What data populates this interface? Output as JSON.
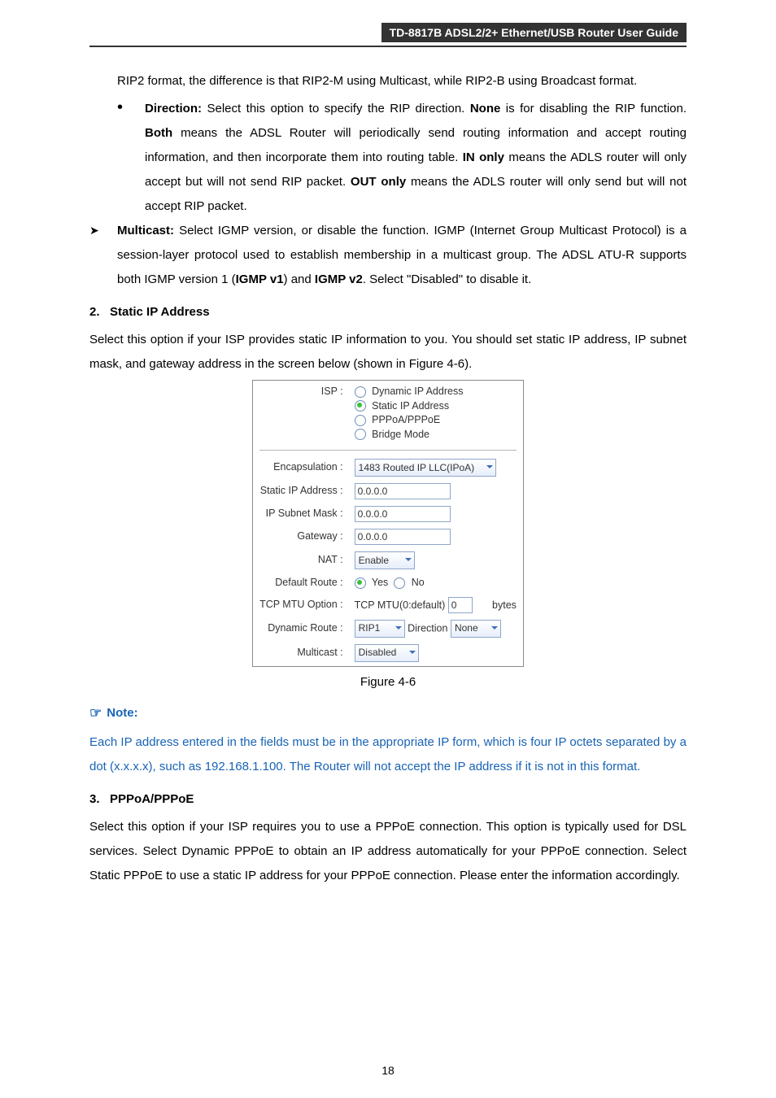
{
  "header": {
    "title": "TD-8817B   ADSL2/2+  Ethernet/USB  Router  User  Guide"
  },
  "body": {
    "p1": "RIP2 format, the difference is that RIP2-M using Multicast, while RIP2-B using Broadcast format.",
    "dir_label": "Direction:",
    "dir_text": " Select this option to specify the RIP direction. ",
    "none": "None",
    "dir_text2": " is for disabling the RIP function. ",
    "both": "Both",
    "dir_text3": " means the ADSL Router will periodically send routing information and accept routing information, and then incorporate them into routing table. ",
    "inonly": "IN only",
    "dir_text4": " means the ADLS router will only accept but will not send RIP packet. ",
    "outonly": "OUT only",
    "dir_text5": " means the ADLS router will only send but will not accept RIP packet.",
    "mcast_label": "Multicast:",
    "mcast_text1": " Select IGMP version, or disable the function. IGMP (Internet Group Multicast Protocol) is a session-layer protocol used to establish membership in a multicast group. The ADSL ATU-R supports both IGMP version 1 (",
    "igmpv1": "IGMP v1",
    "mcast_text2": ") and ",
    "igmpv2": "IGMP v2",
    "mcast_text3": ". Select \"Disabled\" to disable it.",
    "s2_num": "2.",
    "s2_title": "Static IP Address",
    "p2": "Select this option if your ISP provides static IP information to you. You should set static IP address, IP subnet mask, and gateway address in the screen below (shown in Figure 4-6).",
    "fig_caption": "Figure 4-6",
    "note_head": "Note:",
    "note_body": "Each IP address entered in the fields must be in the appropriate IP form, which is four IP octets separated by a dot (x.x.x.x), such as 192.168.1.100. The Router will not accept the IP address if it is not in this format.",
    "s3_num": "3.",
    "s3_title": "PPPoA/PPPoE",
    "p3": "Select this option if your ISP requires you to use a PPPoE connection. This option is typically used for DSL services. Select Dynamic PPPoE to obtain an IP address automatically for your PPPoE connection. Select Static PPPoE to use a static IP address for your PPPoE connection. Please enter the information accordingly."
  },
  "figure": {
    "isp_label": "ISP :",
    "opt_dyn": "Dynamic IP Address",
    "opt_static": "Static IP Address",
    "opt_pppoa": "PPPoA/PPPoE",
    "opt_bridge": "Bridge Mode",
    "encap_label": "Encapsulation :",
    "encap_val": "1483 Routed IP LLC(IPoA)",
    "sip_label": "Static IP Address :",
    "sip_val": "0.0.0.0",
    "mask_label": "IP Subnet Mask :",
    "mask_val": "0.0.0.0",
    "gw_label": "Gateway :",
    "gw_val": "0.0.0.0",
    "nat_label": "NAT :",
    "nat_val": "Enable",
    "droute_label": "Default Route :",
    "yes": "Yes",
    "no": "No",
    "mtu_label": "TCP MTU Option :",
    "mtu_text": "TCP MTU(0:default)",
    "mtu_val": "0",
    "bytes": "bytes",
    "dynr_label": "Dynamic Route :",
    "dynr_val": "RIP1",
    "direction": "Direction",
    "dir_val": "None",
    "multicast_label": "Multicast :",
    "multicast_val": "Disabled"
  },
  "page_number": "18"
}
